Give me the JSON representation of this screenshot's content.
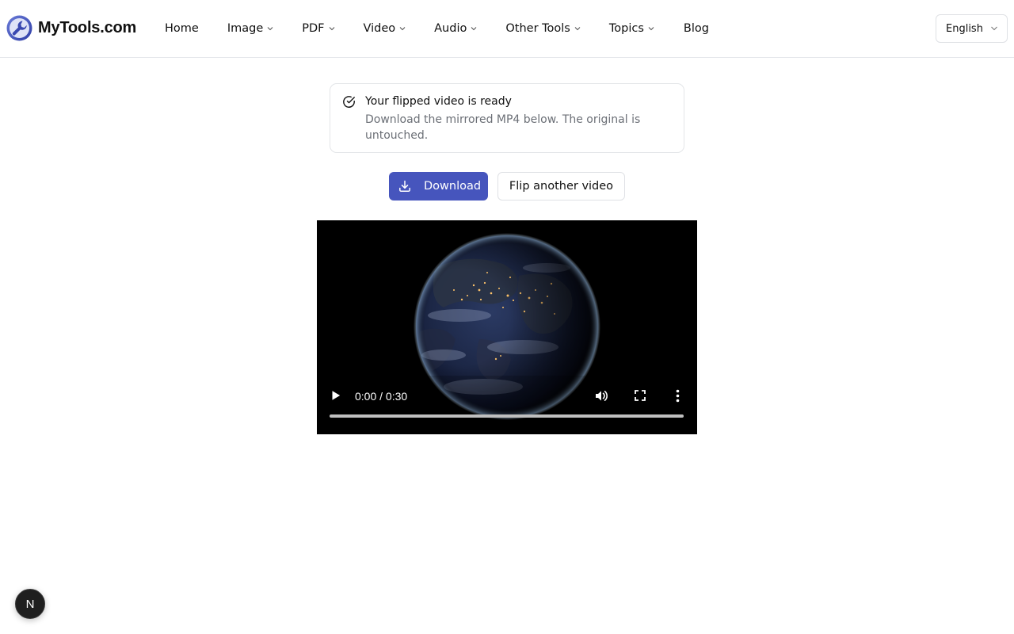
{
  "brand": {
    "name": "MyTools.com",
    "accent": "#4655bd"
  },
  "nav": {
    "items": [
      {
        "label": "Home",
        "dropdown": false
      },
      {
        "label": "Image",
        "dropdown": true
      },
      {
        "label": "PDF",
        "dropdown": true
      },
      {
        "label": "Video",
        "dropdown": true
      },
      {
        "label": "Audio",
        "dropdown": true
      },
      {
        "label": "Other Tools",
        "dropdown": true
      },
      {
        "label": "Topics",
        "dropdown": true
      },
      {
        "label": "Blog",
        "dropdown": false
      }
    ]
  },
  "language": {
    "selected": "English"
  },
  "notice": {
    "icon": "check-circle-icon",
    "title": "Your flipped video is ready",
    "description": "Download the mirrored MP4 below. The original is untouched."
  },
  "actions": {
    "download_label": "Download",
    "download_icon": "download-icon",
    "flip_another_label": "Flip another video"
  },
  "video": {
    "current_time": "0:00",
    "duration": "0:30",
    "time_display": "0:00 / 0:30",
    "progress_fraction": 0,
    "thumbnail_subject": "earth-at-night"
  },
  "dev_badge": {
    "letter": "N"
  }
}
